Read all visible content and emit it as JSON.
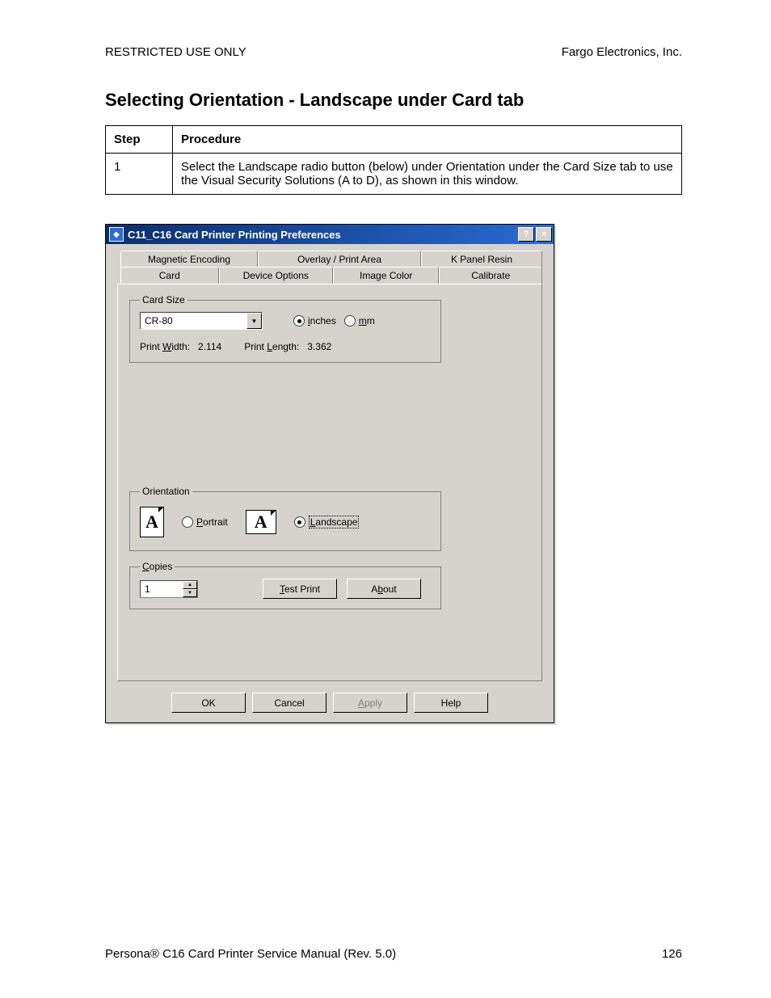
{
  "doc": {
    "restricted": "RESTRICTED USE ONLY",
    "company": "Fargo Electronics, Inc.",
    "section_title": "Selecting Orientation - Landscape under Card tab",
    "table": {
      "h_step": "Step",
      "h_proc": "Procedure",
      "r1_step": "1",
      "r1_proc": "Select the Landscape radio button (below) under Orientation under the Card Size tab to use the Visual Security Solutions (A to D), as shown in this window."
    },
    "footer_left_pre": "Persona",
    "footer_left_reg": "®",
    "footer_left_post": " C16 Card Printer Service Manual (Rev. 5.0)",
    "page_no": "126"
  },
  "dlg": {
    "title": "C11_C16 Card Printer Printing Preferences",
    "help_sym": "?",
    "close_sym": "×",
    "tabs_back": [
      "Magnetic Encoding",
      "Overlay / Print Area",
      "K Panel Resin"
    ],
    "tabs_front": [
      "Card",
      "Device Options",
      "Image Color",
      "Calibrate"
    ],
    "group_card_size": "Card Size",
    "card_size_value": "CR-80",
    "unit_inches_u": "i",
    "unit_inches_rest": "nches",
    "unit_mm_u": "m",
    "unit_mm_rest": "m",
    "print_width_lbl_pre": "Print ",
    "print_width_lbl_u": "W",
    "print_width_lbl_post": "idth:",
    "print_width_val": "2.114",
    "print_length_lbl_pre": "Print ",
    "print_length_lbl_u": "L",
    "print_length_lbl_post": "ength:",
    "print_length_val": "3.362",
    "group_orientation": "Orientation",
    "portrait_u": "P",
    "portrait_rest": "ortrait",
    "landscape_u": "L",
    "landscape_rest": "andscape",
    "group_copies_u": "C",
    "group_copies_rest": "opies",
    "copies_value": "1",
    "btn_test_u": "T",
    "btn_test_rest": "est Print",
    "btn_about_pre": "A",
    "btn_about_u": "b",
    "btn_about_post": "out",
    "btn_ok": "OK",
    "btn_cancel": "Cancel",
    "btn_apply_u": "A",
    "btn_apply_rest": "pply",
    "btn_help": "Help",
    "letter": "A"
  }
}
